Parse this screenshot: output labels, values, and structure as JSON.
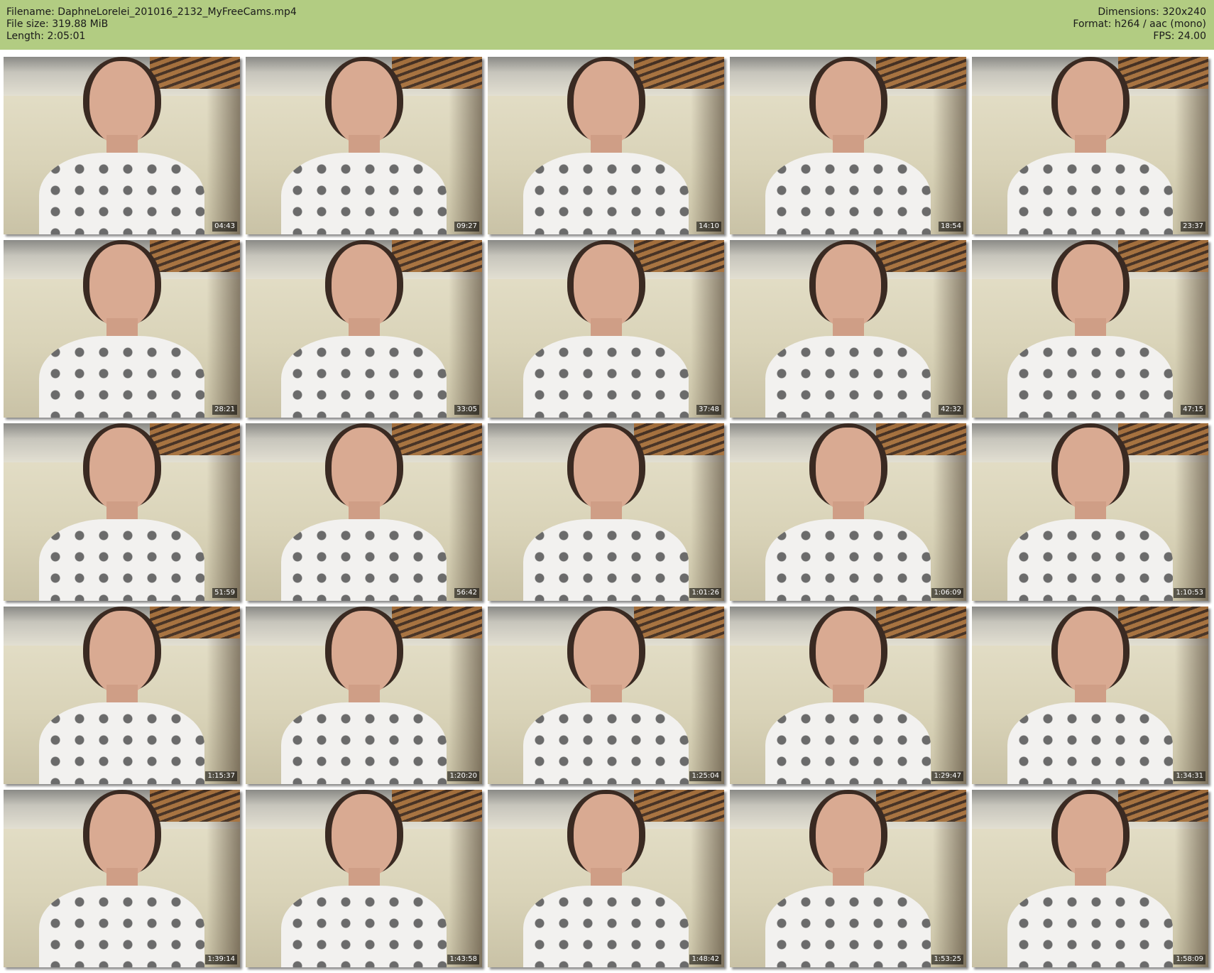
{
  "header": {
    "filename_label": "Filename: DaphneLorelei_201016_2132_MyFreeCams.mp4",
    "filesize_label": "File size: 319.88 MiB",
    "length_label": "Length: 2:05:01",
    "dimensions_label": "Dimensions: 320x240",
    "format_label": "Format: h264 / aac (mono)",
    "fps_label": "FPS: 24.00",
    "background_color": "#b2cc82"
  },
  "thumbnails": [
    {
      "timestamp": "04:43"
    },
    {
      "timestamp": "09:27"
    },
    {
      "timestamp": "14:10"
    },
    {
      "timestamp": "18:54"
    },
    {
      "timestamp": "23:37"
    },
    {
      "timestamp": "28:21"
    },
    {
      "timestamp": "33:05"
    },
    {
      "timestamp": "37:48"
    },
    {
      "timestamp": "42:32"
    },
    {
      "timestamp": "47:15"
    },
    {
      "timestamp": "51:59"
    },
    {
      "timestamp": "56:42"
    },
    {
      "timestamp": "1:01:26"
    },
    {
      "timestamp": "1:06:09"
    },
    {
      "timestamp": "1:10:53"
    },
    {
      "timestamp": "1:15:37"
    },
    {
      "timestamp": "1:20:20"
    },
    {
      "timestamp": "1:25:04"
    },
    {
      "timestamp": "1:29:47"
    },
    {
      "timestamp": "1:34:31"
    },
    {
      "timestamp": "1:39:14"
    },
    {
      "timestamp": "1:43:58"
    },
    {
      "timestamp": "1:48:42"
    },
    {
      "timestamp": "1:53:25"
    },
    {
      "timestamp": "1:58:09"
    }
  ]
}
